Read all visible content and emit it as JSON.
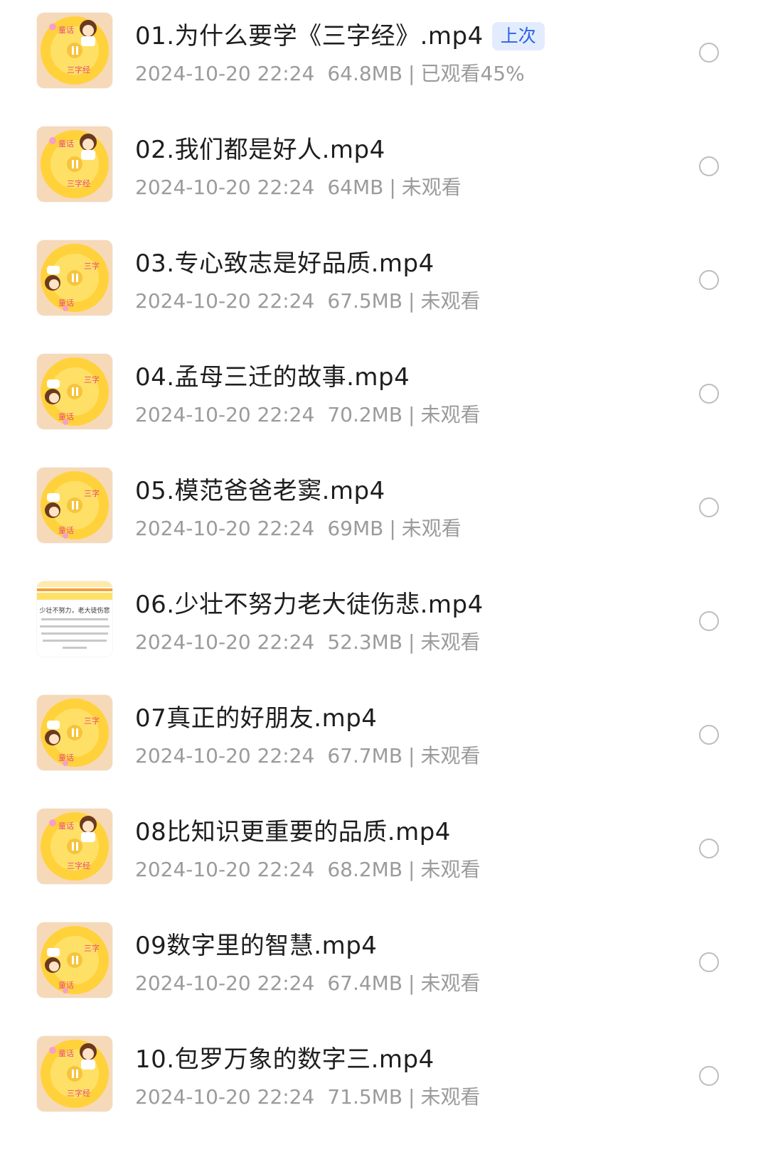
{
  "list": {
    "items": [
      {
        "title": "01.为什么要学《三字经》.mp4",
        "date": "2024-10-20 22:24",
        "size": "64.8MB",
        "status": "已观看45%",
        "badge": "上次",
        "thumb": "cartoon-cover",
        "progress_percent": 45
      },
      {
        "title": "02.我们都是好人.mp4",
        "date": "2024-10-20 22:24",
        "size": "64MB",
        "status": "未观看",
        "thumb": "cartoon-cover"
      },
      {
        "title": "03.专心致志是好品质.mp4",
        "date": "2024-10-20 22:24",
        "size": "67.5MB",
        "status": "未观看",
        "thumb": "cartoon-cover"
      },
      {
        "title": "04.孟母三迁的故事.mp4",
        "date": "2024-10-20 22:24",
        "size": "70.2MB",
        "status": "未观看",
        "thumb": "cartoon-cover"
      },
      {
        "title": "05.模范爸爸老窦.mp4",
        "date": "2024-10-20 22:24",
        "size": "69MB",
        "status": "未观看",
        "thumb": "cartoon-cover"
      },
      {
        "title": "06.少壮不努力老大徒伤悲.mp4",
        "date": "2024-10-20 22:24",
        "size": "52.3MB",
        "status": "未观看",
        "thumb": "text-page",
        "thumb_text": "少壮不努力，老大徒伤悲"
      },
      {
        "title": "07真正的好朋友.mp4",
        "date": "2024-10-20 22:24",
        "size": "67.7MB",
        "status": "未观看",
        "thumb": "cartoon-cover"
      },
      {
        "title": "08比知识更重要的品质.mp4",
        "date": "2024-10-20 22:24",
        "size": "68.2MB",
        "status": "未观看",
        "thumb": "cartoon-cover"
      },
      {
        "title": "09数字里的智慧.mp4",
        "date": "2024-10-20 22:24",
        "size": "67.4MB",
        "status": "未观看",
        "thumb": "cartoon-cover"
      },
      {
        "title": "10.包罗万象的数字三.mp4",
        "date": "2024-10-20 22:24",
        "size": "71.5MB",
        "status": "未观看",
        "thumb": "cartoon-cover"
      }
    ],
    "separator": "|"
  },
  "colors": {
    "title": "#1e1e1e",
    "meta": "#9b9b9b",
    "badge_bg": "#e3ecff",
    "badge_text": "#2c62e8",
    "radio_border": "#bdbdbd",
    "cover_yellow": "#ffd23c",
    "cover_bg": "#f6d9b8"
  }
}
